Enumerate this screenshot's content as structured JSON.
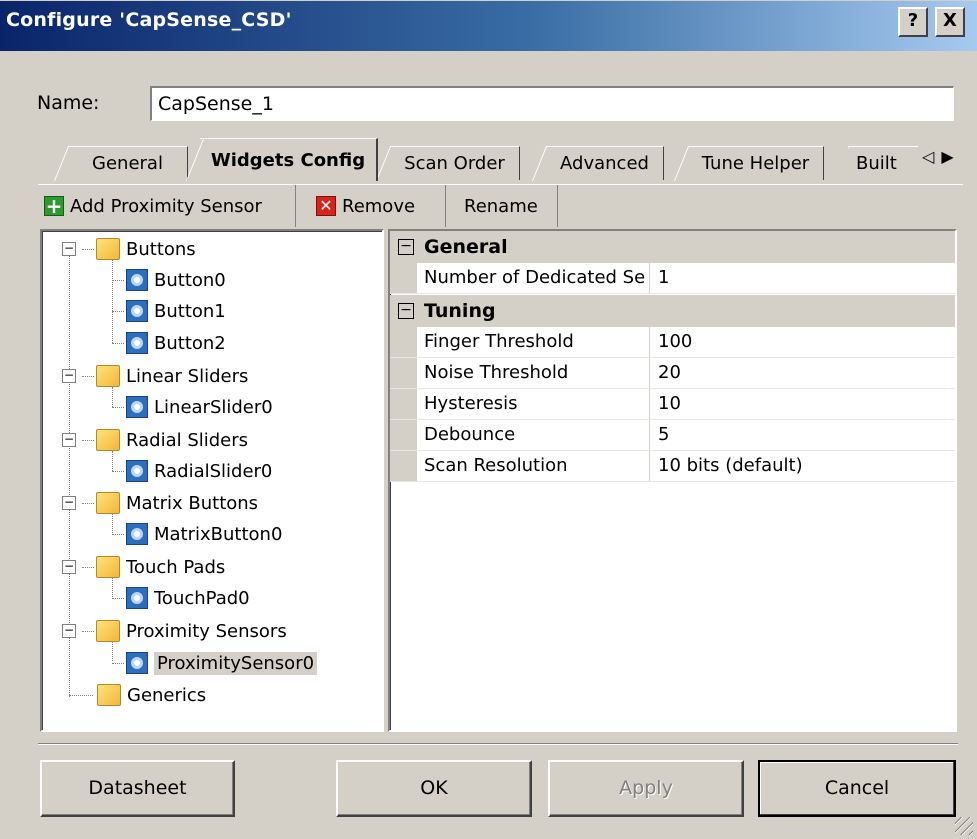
{
  "window": {
    "title": "Configure 'CapSense_CSD'",
    "help_button": "?",
    "close_button": "X"
  },
  "name_field": {
    "label": "Name:",
    "value": "CapSense_1"
  },
  "tabs": [
    {
      "label": "General",
      "active": false
    },
    {
      "label": "Widgets Config",
      "active": true
    },
    {
      "label": "Scan Order",
      "active": false
    },
    {
      "label": "Advanced",
      "active": false
    },
    {
      "label": "Tune Helper",
      "active": false
    },
    {
      "label": "Built",
      "active": false
    }
  ],
  "tab_scroll": {
    "left": "◁",
    "right": "▶"
  },
  "toolbar": {
    "add_label": "Add Proximity Sensor",
    "remove_label": "Remove",
    "rename_label": "Rename"
  },
  "tree": {
    "groups": [
      {
        "label": "Buttons",
        "children": [
          "Button0",
          "Button1",
          "Button2"
        ]
      },
      {
        "label": "Linear Sliders",
        "children": [
          "LinearSlider0"
        ]
      },
      {
        "label": "Radial Sliders",
        "children": [
          "RadialSlider0"
        ]
      },
      {
        "label": "Matrix Buttons",
        "children": [
          "MatrixButton0"
        ]
      },
      {
        "label": "Touch Pads",
        "children": [
          "TouchPad0"
        ]
      },
      {
        "label": "Proximity Sensors",
        "children": [
          "ProximitySensor0"
        ]
      },
      {
        "label": "Generics",
        "children": []
      }
    ],
    "expander_symbol": "−",
    "selected": "ProximitySensor0"
  },
  "properties": {
    "categories": [
      {
        "label": "General",
        "rows": [
          {
            "name": "Number of Dedicated Se",
            "value": "1"
          }
        ]
      },
      {
        "label": "Tuning",
        "rows": [
          {
            "name": "Finger Threshold",
            "value": "100"
          },
          {
            "name": "Noise Threshold",
            "value": "20"
          },
          {
            "name": "Hysteresis",
            "value": "10"
          },
          {
            "name": "Debounce",
            "value": "5"
          },
          {
            "name": "Scan Resolution",
            "value": "10 bits (default)"
          }
        ]
      }
    ],
    "collapse_symbol": "−"
  },
  "buttons": {
    "datasheet": "Datasheet",
    "ok": "OK",
    "apply": "Apply",
    "cancel": "Cancel"
  }
}
